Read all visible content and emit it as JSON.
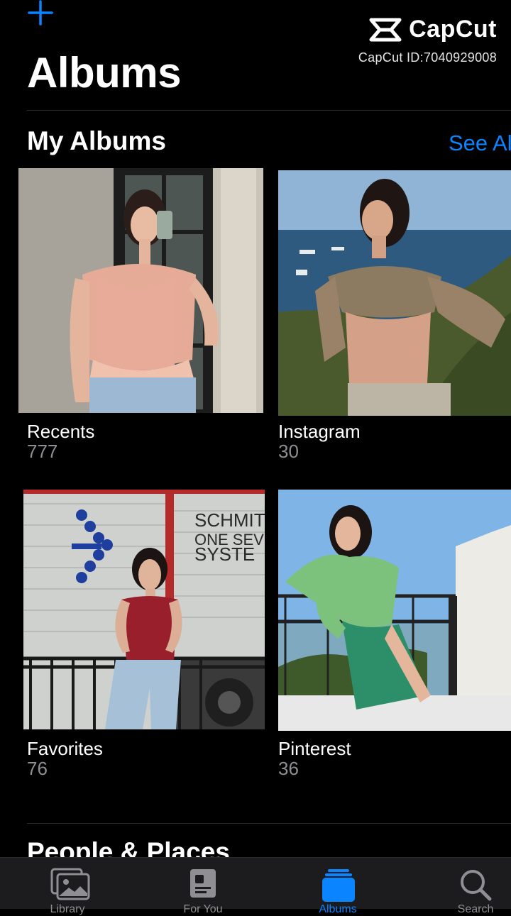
{
  "header": {
    "add_icon": "plus-icon",
    "title": "Albums"
  },
  "watermark": {
    "logo_icon": "capcut-logo-icon",
    "name": "CapCut",
    "id_text": "CapCut ID:7040929008"
  },
  "my_albums": {
    "title": "My Albums",
    "see_all": "See All",
    "albums": [
      {
        "name": "Recents",
        "count": "777"
      },
      {
        "name": "Instagram",
        "count": "30"
      },
      {
        "name": "Favorites",
        "count": "76"
      },
      {
        "name": "Pinterest",
        "count": "36"
      }
    ]
  },
  "people_places": {
    "title": "People & Places"
  },
  "tabbar": {
    "tabs": [
      {
        "icon": "photos-icon",
        "label": "Library",
        "active": false
      },
      {
        "icon": "for-you-icon",
        "label": "For You",
        "active": false
      },
      {
        "icon": "albums-icon",
        "label": "Albums",
        "active": true
      },
      {
        "icon": "search-icon",
        "label": "Search",
        "active": false
      }
    ]
  },
  "colors": {
    "accent": "#0a84ff",
    "background": "#000000",
    "secondary_text": "#8e8e93"
  },
  "thumb_text": {
    "truck_line1": "SCHMIT",
    "truck_line2": "ONE SEV",
    "truck_line3": "SYSTE"
  }
}
